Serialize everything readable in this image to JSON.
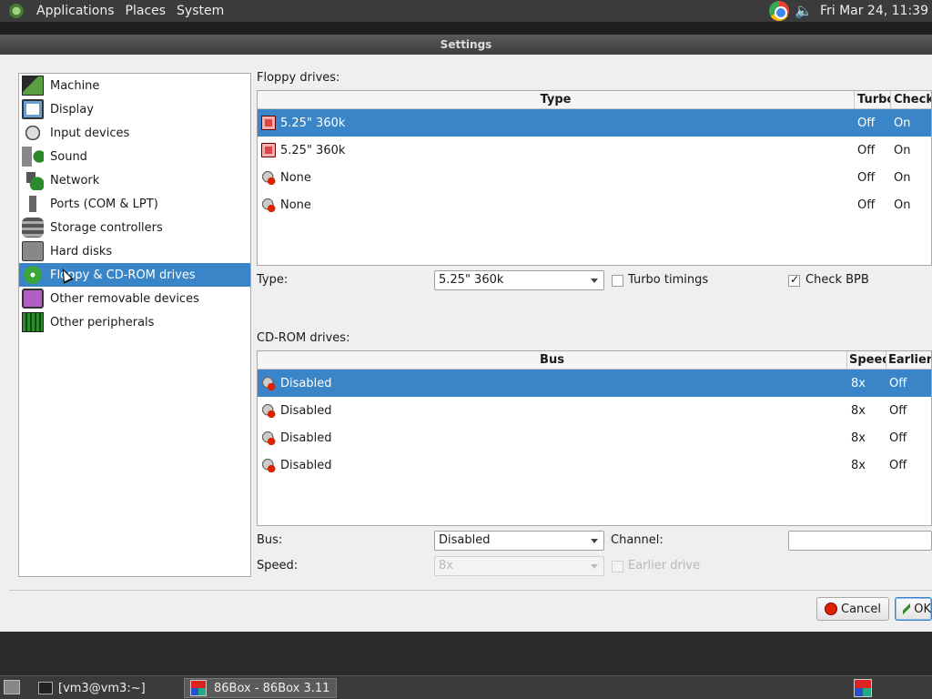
{
  "top_panel": {
    "menus": [
      "Applications",
      "Places",
      "System"
    ],
    "clock": "Fri Mar 24, 11:39"
  },
  "window": {
    "title": "Settings"
  },
  "sidebar": {
    "items": [
      {
        "label": "Machine",
        "icon": "machine-icon"
      },
      {
        "label": "Display",
        "icon": "display-icon"
      },
      {
        "label": "Input devices",
        "icon": "input-devices-icon"
      },
      {
        "label": "Sound",
        "icon": "sound-icon"
      },
      {
        "label": "Network",
        "icon": "network-icon"
      },
      {
        "label": "Ports (COM & LPT)",
        "icon": "ports-icon"
      },
      {
        "label": "Storage controllers",
        "icon": "storage-icon"
      },
      {
        "label": "Hard disks",
        "icon": "hard-disk-icon"
      },
      {
        "label": "Floppy & CD-ROM drives",
        "icon": "floppy-cdrom-icon",
        "selected": true
      },
      {
        "label": "Other removable devices",
        "icon": "removable-icon"
      },
      {
        "label": "Other peripherals",
        "icon": "peripherals-icon"
      }
    ]
  },
  "floppy": {
    "section_label": "Floppy drives:",
    "columns": [
      "Type",
      "Turbo",
      "Check"
    ],
    "rows": [
      {
        "type": "5.25\" 360k",
        "turbo": "Off",
        "check": "On",
        "selected": true
      },
      {
        "type": "5.25\" 360k",
        "turbo": "Off",
        "check": "On"
      },
      {
        "type": "None",
        "turbo": "Off",
        "check": "On"
      },
      {
        "type": "None",
        "turbo": "Off",
        "check": "On"
      }
    ],
    "type_label": "Type:",
    "type_value": "5.25\" 360k",
    "turbo_label": "Turbo timings",
    "turbo_checked": false,
    "check_bpb_label": "Check BPB",
    "check_bpb_checked": true
  },
  "cdrom": {
    "section_label": "CD-ROM drives:",
    "columns": [
      "Bus",
      "Speed",
      "Earlier d"
    ],
    "rows": [
      {
        "bus": "Disabled",
        "speed": "8x",
        "earlier": "Off",
        "selected": true
      },
      {
        "bus": "Disabled",
        "speed": "8x",
        "earlier": "Off"
      },
      {
        "bus": "Disabled",
        "speed": "8x",
        "earlier": "Off"
      },
      {
        "bus": "Disabled",
        "speed": "8x",
        "earlier": "Off"
      }
    ],
    "bus_label": "Bus:",
    "bus_value": "Disabled",
    "channel_label": "Channel:",
    "speed_label": "Speed:",
    "speed_value": "8x",
    "earlier_label": "Earlier drive"
  },
  "buttons": {
    "cancel": "Cancel",
    "ok": "OK"
  },
  "taskbar": {
    "tasks": [
      "[vm3@vm3:~]",
      "86Box - 86Box 3.11"
    ]
  }
}
